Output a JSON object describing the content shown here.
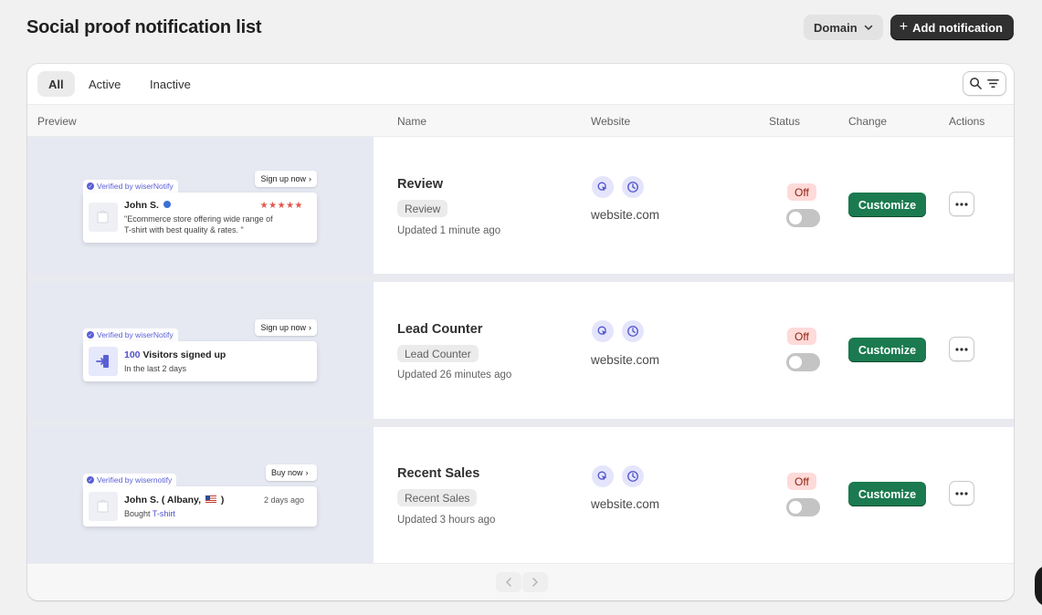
{
  "page": {
    "title": "Social proof notification list",
    "domain_button": "Domain",
    "add_button": "Add notification"
  },
  "tabs": [
    {
      "label": "All",
      "active": true
    },
    {
      "label": "Active",
      "active": false
    },
    {
      "label": "Inactive",
      "active": false
    }
  ],
  "table": {
    "headers": {
      "preview": "Preview",
      "name": "Name",
      "website": "Website",
      "status": "Status",
      "change": "Change",
      "actions": "Actions"
    },
    "rows": [
      {
        "preview": {
          "cta": "Sign up now",
          "verified": "Verified by wiserNotify",
          "name": "John S.",
          "rating": "★★★★★",
          "text_line1": "\"Ecommerce store offering wide range of",
          "text_line2": "T-shirt with best quality & rates. \""
        },
        "name": "Review",
        "type": "Review",
        "updated": "Updated 1 minute ago",
        "website": "website.com",
        "status": "Off",
        "action_label": "Customize"
      },
      {
        "preview": {
          "cta": "Sign up now",
          "verified": "Verified by wiserNotify",
          "count": "100",
          "headline": "Visitors signed up",
          "subtext": "In the last 2 days"
        },
        "name": "Lead Counter",
        "type": "Lead Counter",
        "updated": "Updated 26 minutes ago",
        "website": "website.com",
        "status": "Off",
        "action_label": "Customize"
      },
      {
        "preview": {
          "cta": "Buy now",
          "verified": "Verified by wisernotify",
          "name": "John S. ( Albany,",
          "name_end": ")",
          "time": "2 days ago",
          "bought": "Bought",
          "product": "T-shirt"
        },
        "name": "Recent Sales",
        "type": "Recent Sales",
        "updated": "Updated 3 hours ago",
        "website": "website.com",
        "status": "Off",
        "action_label": "Customize"
      }
    ]
  },
  "colors": {
    "accent": "#5a5fd6",
    "primary_button": "#1b7a4f",
    "off_badge": "#fedad9",
    "star": "#e2574c"
  },
  "icons": [
    "chevron-down-icon",
    "plus-icon",
    "search-icon",
    "filter-icon",
    "cursor-click-icon",
    "clock-icon",
    "more-horizontal-icon",
    "chevron-left-icon",
    "chevron-right-icon"
  ]
}
